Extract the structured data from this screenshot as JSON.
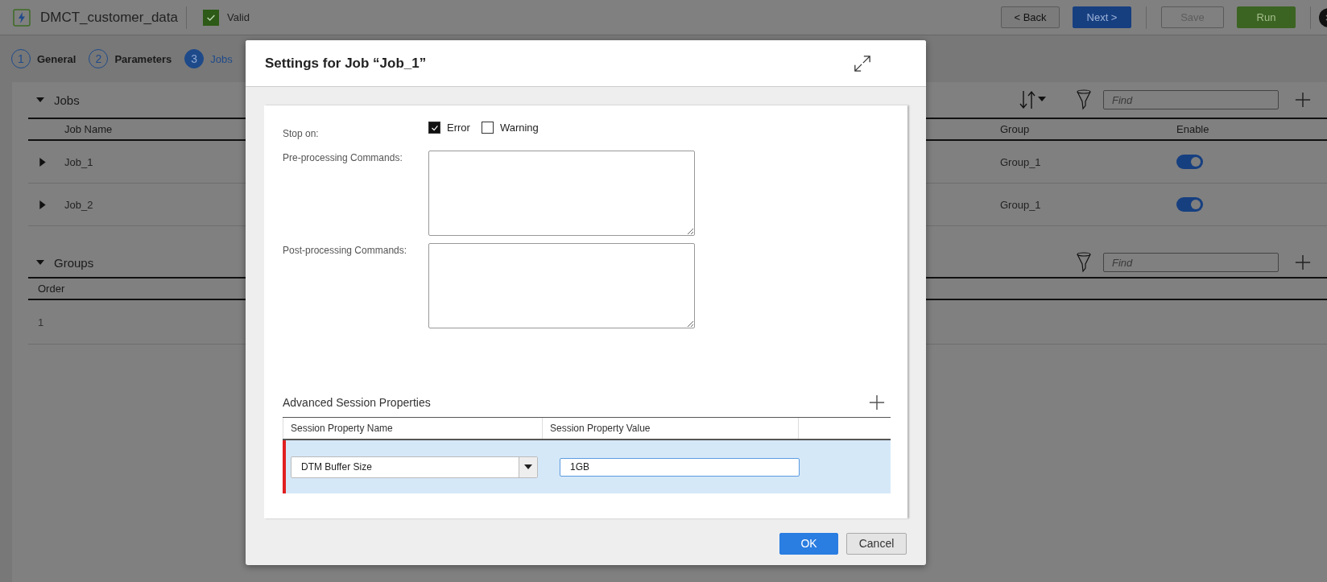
{
  "app_bar": {
    "title": "DMCT_customer_data",
    "valid": {
      "checked": true,
      "label": "Valid"
    },
    "buttons": [
      {
        "label": "< Back",
        "kind": "secondary",
        "disabled": false
      },
      {
        "label": "Next >",
        "kind": "primary",
        "disabled": false
      },
      {
        "label": "Save",
        "kind": "secondary",
        "disabled": true
      },
      {
        "label": "Run",
        "kind": "run",
        "disabled": false
      }
    ]
  },
  "steps": [
    {
      "number": "1",
      "label": "General",
      "selected": false
    },
    {
      "number": "2",
      "label": "Parameters",
      "selected": false
    },
    {
      "number": "3",
      "label": "Jobs",
      "selected": true
    }
  ],
  "jobs_section": {
    "title": "Jobs",
    "expanded": true,
    "find_placeholder": "Find",
    "columns": [
      "Job Name",
      "Group",
      "Enable"
    ],
    "rows": [
      {
        "name": "Job_1",
        "group": "Group_1",
        "enabled": true
      },
      {
        "name": "Job_2",
        "group": "Group_1",
        "enabled": true
      }
    ]
  },
  "groups_section": {
    "title": "Groups",
    "expanded": true,
    "find_placeholder": "Find",
    "columns": [
      "Order"
    ],
    "rows": [
      {
        "order": "1"
      }
    ]
  },
  "dialog": {
    "title": "Settings for Job “Job_1”",
    "stop_on_label": "Stop on:",
    "stop_on": [
      {
        "label": "Error",
        "checked": true
      },
      {
        "label": "Warning",
        "checked": false
      }
    ],
    "pre_label": "Pre-processing Commands:",
    "post_label": "Post-processing Commands:",
    "advanced": {
      "title": "Advanced Session Properties",
      "columns": [
        "Session Property Name",
        "Session Property Value"
      ],
      "rows": [
        {
          "name": "DTM Buffer Size",
          "value": "1GB",
          "selected": true
        }
      ]
    },
    "buttons": [
      {
        "label": "OK",
        "kind": "primary"
      },
      {
        "label": "Cancel",
        "kind": "secondary"
      }
    ]
  }
}
